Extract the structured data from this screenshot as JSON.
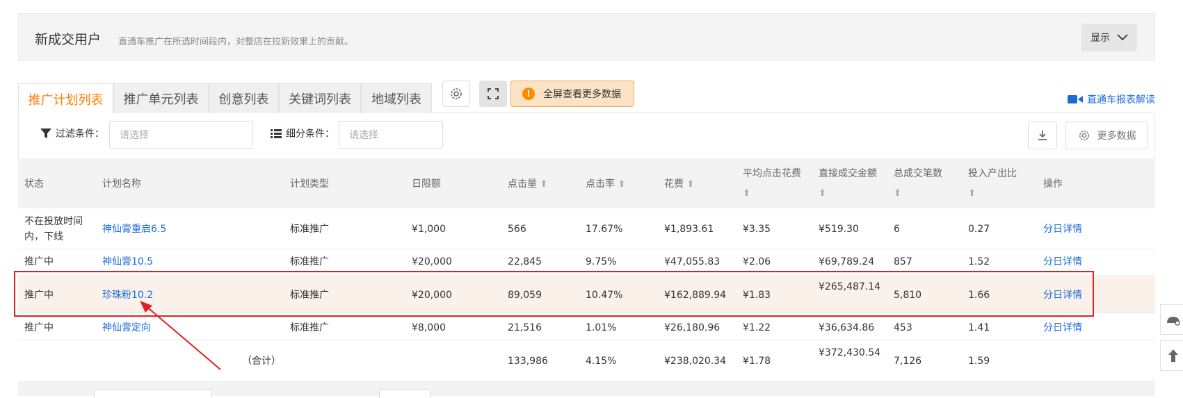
{
  "header": {
    "title": "新成交用户",
    "subtitle": "直通车推广在所选时间段内，对整店在拉新效果上的贡献。",
    "display_button": "显示"
  },
  "tabs": [
    {
      "label": "推广计划列表",
      "active": true
    },
    {
      "label": "推广单元列表",
      "active": false
    },
    {
      "label": "创意列表",
      "active": false
    },
    {
      "label": "关键词列表",
      "active": false
    },
    {
      "label": "地域列表",
      "active": false
    }
  ],
  "toolbar": {
    "fullscreen_banner": "全屏查看更多数据",
    "report_link": "直通车报表解读"
  },
  "filters": {
    "filter_label": "过滤条件：",
    "filter_placeholder": "请选择",
    "segment_label": "细分条件：",
    "segment_placeholder": "请选择",
    "more_data": "更多数据"
  },
  "table": {
    "columns": [
      "状态",
      "计划名称",
      "计划类型",
      "日限额",
      "点击量",
      "点击率",
      "花费",
      "平均点击花费",
      "直接成交金额",
      "总成交笔数",
      "投入产出比",
      "操作"
    ],
    "rows": [
      {
        "status": "不在投放时间内，下线",
        "name": "神仙膏重启6.5",
        "type": "标准推广",
        "budget": "¥1,000",
        "clicks": "566",
        "ctr": "17.67%",
        "cost": "¥1,893.61",
        "cpc": "¥3.35",
        "gmv": "¥519.30",
        "orders": "6",
        "roi": "0.27",
        "action": "分日详情"
      },
      {
        "status": "推广中",
        "name": "神仙膏10.5",
        "type": "标准推广",
        "budget": "¥20,000",
        "clicks": "22,845",
        "ctr": "9.75%",
        "cost": "¥47,055.83",
        "cpc": "¥2.06",
        "gmv": "¥69,789.24",
        "orders": "857",
        "roi": "1.52",
        "action": "分日详情"
      },
      {
        "status": "推广中",
        "name": "珍珠粉10.2",
        "type": "标准推广",
        "budget": "¥20,000",
        "clicks": "89,059",
        "ctr": "10.47%",
        "cost": "¥162,889.94",
        "cpc": "¥1.83",
        "gmv": "¥265,487.14",
        "orders": "5,810",
        "roi": "1.66",
        "action": "分日详情"
      },
      {
        "status": "推广中",
        "name": "神仙膏定向",
        "type": "标准推广",
        "budget": "¥8,000",
        "clicks": "21,516",
        "ctr": "1.01%",
        "cost": "¥26,180.96",
        "cpc": "¥1.22",
        "gmv": "¥36,634.86",
        "orders": "453",
        "roi": "1.41",
        "action": "分日详情"
      }
    ],
    "total": {
      "label": "（合计）",
      "clicks": "133,986",
      "ctr": "4.15%",
      "cost": "¥238,020.34",
      "cpc": "¥1.78",
      "gmv": "¥372,430.54",
      "orders": "7,126",
      "roi": "1.59"
    }
  },
  "colors": {
    "accent": "#ff7d00",
    "link": "#1b6bd6",
    "highlight": "#e02020"
  }
}
